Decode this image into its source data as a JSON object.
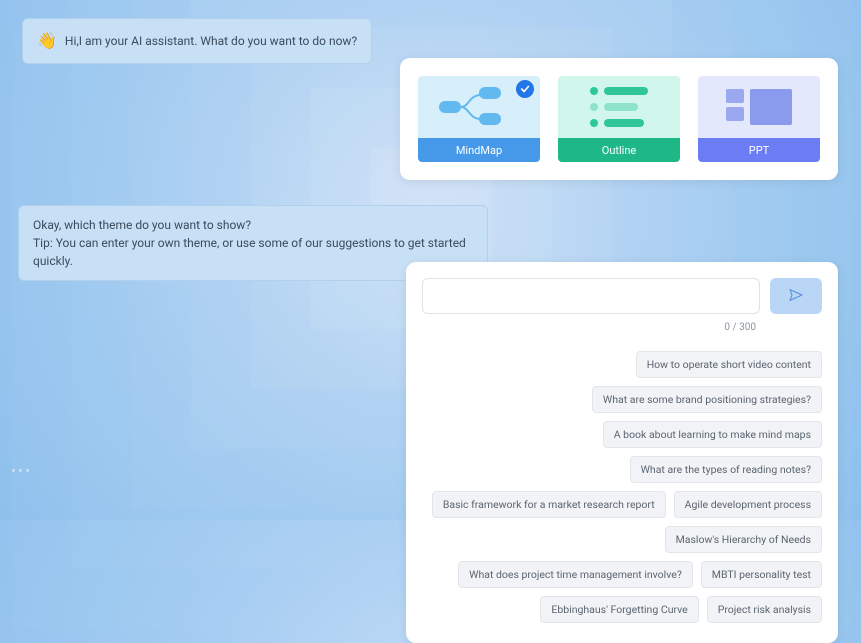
{
  "messages": {
    "greeting": "Hi,I am your AI assistant. What do you want to do now?",
    "theme_prompt_line1": "Okay, which theme do you want to show?",
    "theme_prompt_line2": "Tip: You can enter your own theme, or use some of our suggestions to get started quickly."
  },
  "options": {
    "mindmap": {
      "label": "MindMap",
      "selected": true
    },
    "outline": {
      "label": "Outline",
      "selected": false
    },
    "ppt": {
      "label": "PPT",
      "selected": false
    }
  },
  "input": {
    "value": "",
    "placeholder": "",
    "counter": "0 / 300"
  },
  "suggestions": [
    "How to operate short video content",
    "What are some brand positioning strategies?",
    "A book about learning to make mind maps",
    "What are the types of reading notes?",
    "Basic framework for a market research report",
    "Agile development process",
    "Maslow's Hierarchy of Needs",
    "What does project time management involve?",
    "MBTI personality test",
    "Ebbinghaus' Forgetting Curve",
    "Project risk analysis"
  ]
}
